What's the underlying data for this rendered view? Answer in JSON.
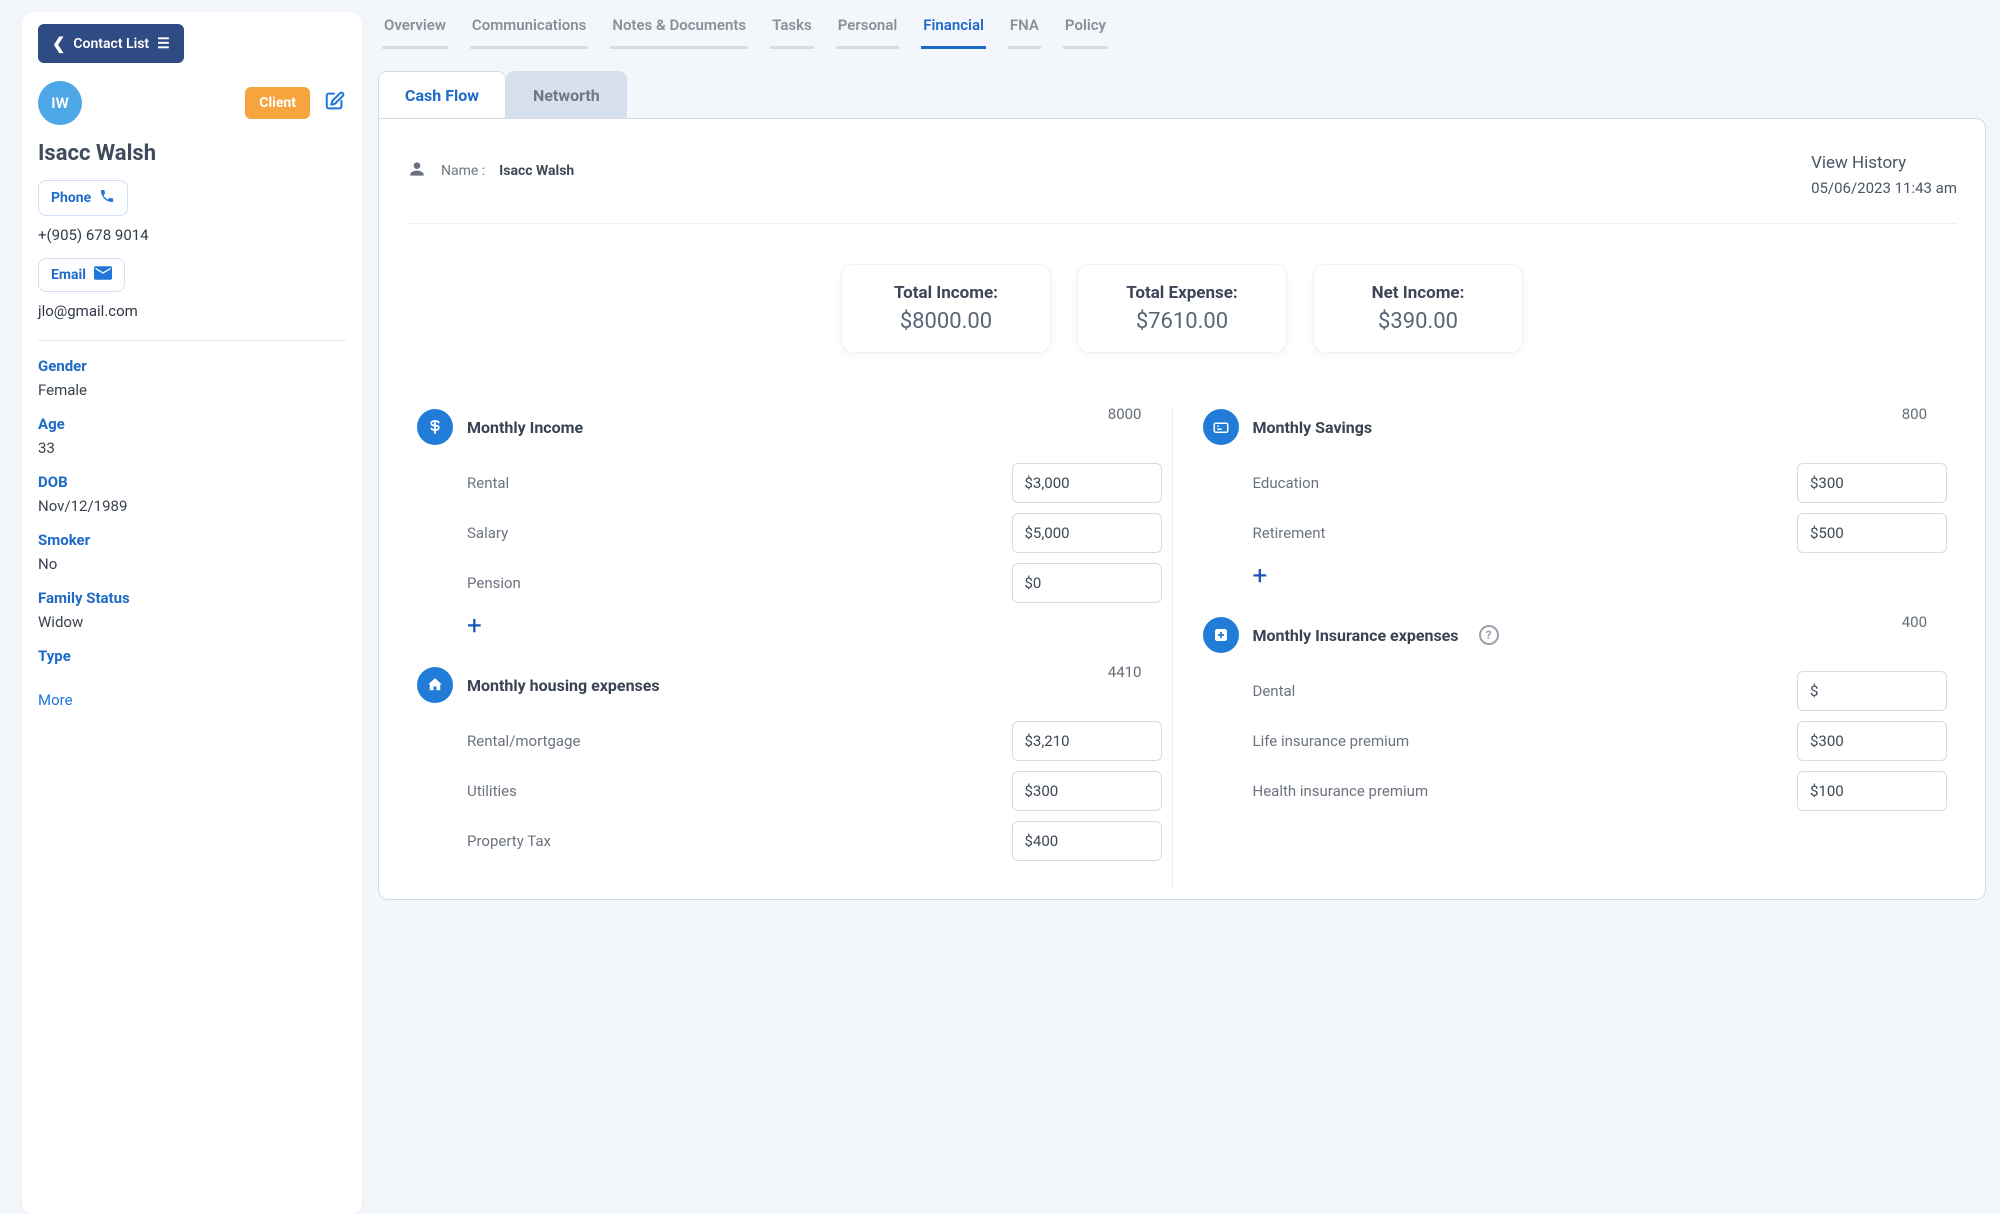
{
  "sidebar": {
    "back_label": "Contact List",
    "avatar_initials": "IW",
    "client_badge": "Client",
    "contact_name": "Isacc Walsh",
    "phone_label": "Phone",
    "phone_value": "+(905) 678 9014",
    "email_label": "Email",
    "email_value": "jlo@gmail.com",
    "fields": {
      "gender_label": "Gender",
      "gender_value": "Female",
      "age_label": "Age",
      "age_value": "33",
      "dob_label": "DOB",
      "dob_value": "Nov/12/1989",
      "smoker_label": "Smoker",
      "smoker_value": "No",
      "family_status_label": "Family Status",
      "family_status_value": "Widow",
      "type_label": "Type",
      "type_value": ""
    },
    "more_label": "More"
  },
  "topnav": {
    "items": [
      "Overview",
      "Communications",
      "Notes & Documents",
      "Tasks",
      "Personal",
      "Financial",
      "FNA",
      "Policy"
    ],
    "active_index": 5
  },
  "subtabs": {
    "items": [
      "Cash Flow",
      "Networth"
    ],
    "active_index": 0
  },
  "panel": {
    "name_label": "Name :",
    "name_value": "Isacc Walsh",
    "view_history_label": "View History",
    "history_timestamp": "05/06/2023 11:43 am"
  },
  "summary": {
    "total_income_label": "Total Income:",
    "total_income_value": "$8000.00",
    "total_expense_label": "Total Expense:",
    "total_expense_value": "$7610.00",
    "net_income_label": "Net Income:",
    "net_income_value": "$390.00"
  },
  "sections": {
    "income": {
      "title": "Monthly Income",
      "total": "8000",
      "items": [
        {
          "label": "Rental",
          "value": "$3,000"
        },
        {
          "label": "Salary",
          "value": "$5,000"
        },
        {
          "label": "Pension",
          "value": "$0"
        }
      ]
    },
    "savings": {
      "title": "Monthly Savings",
      "total": "800",
      "items": [
        {
          "label": "Education",
          "value": "$300"
        },
        {
          "label": "Retirement",
          "value": "$500"
        }
      ]
    },
    "housing": {
      "title": "Monthly housing expenses",
      "total": "4410",
      "items": [
        {
          "label": "Rental/mortgage",
          "value": "$3,210"
        },
        {
          "label": "Utilities",
          "value": "$300"
        },
        {
          "label": "Property Tax",
          "value": "$400"
        }
      ]
    },
    "insurance": {
      "title": "Monthly Insurance expenses",
      "total": "400",
      "items": [
        {
          "label": "Dental",
          "value": "$"
        },
        {
          "label": "Life insurance premium",
          "value": "$300"
        },
        {
          "label": "Health insurance premium",
          "value": "$100"
        }
      ]
    }
  }
}
